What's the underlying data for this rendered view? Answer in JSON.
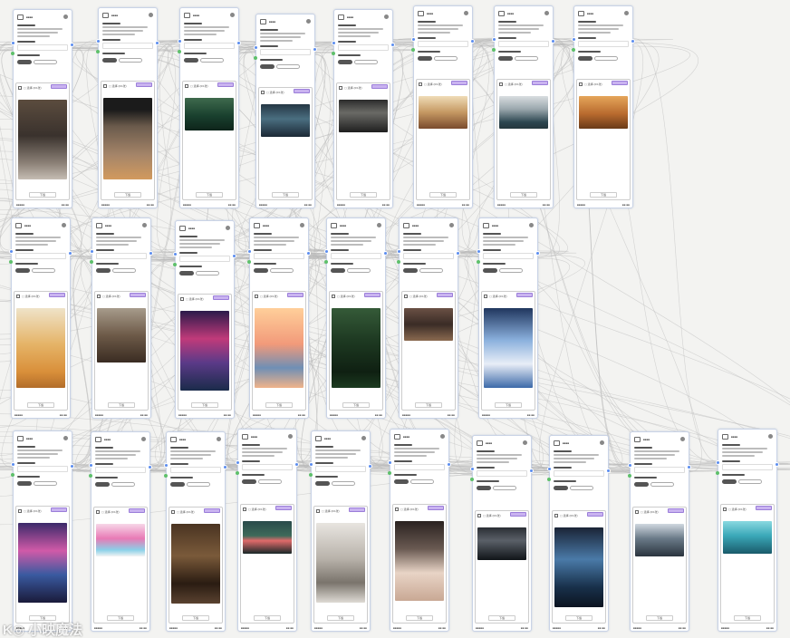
{
  "node": {
    "title": "■■■■",
    "select_label": "▢ 选择  (0/1张)",
    "download_label": "下载",
    "footer_left": "■■■■■",
    "footer_right": "■■ ■■"
  },
  "watermark": {
    "text": "K◎ 小映魔法"
  },
  "colors": {
    "accent": "#5b8def",
    "port_green": "#5ec06b",
    "tag": "#c9b3f0",
    "wire": "#b8b8b8"
  },
  "rows": [
    {
      "nodes": [
        {
          "image": "linear-gradient(180deg,#5b4c3e,#3a322d 45%,#8d8278 80%,#c5bdb3)"
        },
        {
          "image": "linear-gradient(180deg,#1b1b1b 0%,#1b1b1b 15%,#6b5b4c 35%,#a58569 70%,#d29a5e)"
        },
        {
          "image": "linear-gradient(180deg,#3f6a4d,#19402e 55%,#0e241a)"
        },
        {
          "image": "linear-gradient(180deg,#253744,#4a6e80 45%,#1b2835)"
        },
        {
          "image": "linear-gradient(180deg,#2b2b2b,#6a6a66 40%,#1f1f1f)"
        },
        {
          "image": "linear-gradient(180deg,#efdcb7,#c59862 50%,#7a4b2c)"
        },
        {
          "image": "linear-gradient(180deg,#d9dde0,#9aa7ad 40%,#2c4650 80%,#24373d)"
        },
        {
          "image": "linear-gradient(180deg,#e5a55a,#b86a2e 55%,#6a3a18)"
        }
      ]
    },
    {
      "nodes": [
        {
          "image": "linear-gradient(180deg,#efe3c8,#e5b468 45%,#d98f3a 80%,#b26d2a)"
        },
        {
          "image": "linear-gradient(180deg,#a79b8b,#6d5a48 50%,#3a2c22)"
        },
        {
          "image": "linear-gradient(180deg,#2b1a4a,#c03a7a 35%,#5b3a88 65%,#1a2b4a)"
        },
        {
          "image": "linear-gradient(180deg,#ffcf9a,#f29a7a 45%,#6f8fb5 75%,#f0b38a)"
        },
        {
          "image": "linear-gradient(180deg,#355a38,#1e3a22 40%,#0f2012 80%,#1c3b20)"
        },
        {
          "image": "linear-gradient(180deg,#6a5044,#3a2c26 50%,#8a6a50)"
        },
        {
          "image": "linear-gradient(180deg,#20365e,#8ab0dd 40%,#e8eef7 70%,#3c6aa8)"
        }
      ]
    },
    {
      "nodes": [
        {
          "image": "linear-gradient(180deg,#3b2a6a,#d05aa8 35%,#3a5aa0 65%,#1a1a3a)"
        },
        {
          "image": "linear-gradient(180deg,#f7d7e8,#e87ab5 45%,#8ad0e8 80%,#f3f3f3)"
        },
        {
          "image": "linear-gradient(180deg,#4a3422,#7a5a3a 40%,#2a1c12 75%,#5a4230)"
        },
        {
          "image": "linear-gradient(180deg,#2a4a4a,#3e6a5a 45%,#e06a6a 60%,#182828)"
        },
        {
          "image": "linear-gradient(180deg,#e8e5e0,#b8b2aa 45%,#7a746c 75%,#dedad4)"
        },
        {
          "image": "linear-gradient(180deg,#2a2220,#6a5a52 35%,#e8d4c6 65%,#c9a894)"
        },
        {
          "image": "linear-gradient(180deg,#2a2e34,#5a6068 40%,#101418)"
        },
        {
          "image": "linear-gradient(180deg,#1a2436,#4a7aa8 40%,#18304a 75%,#0c1420)"
        },
        {
          "image": "linear-gradient(180deg,#d0d8e0,#6a7a88 45%,#2a343e)"
        },
        {
          "image": "linear-gradient(180deg,#8ad8e0,#3aa8b8 45%,#1a5a6a)"
        }
      ]
    }
  ]
}
